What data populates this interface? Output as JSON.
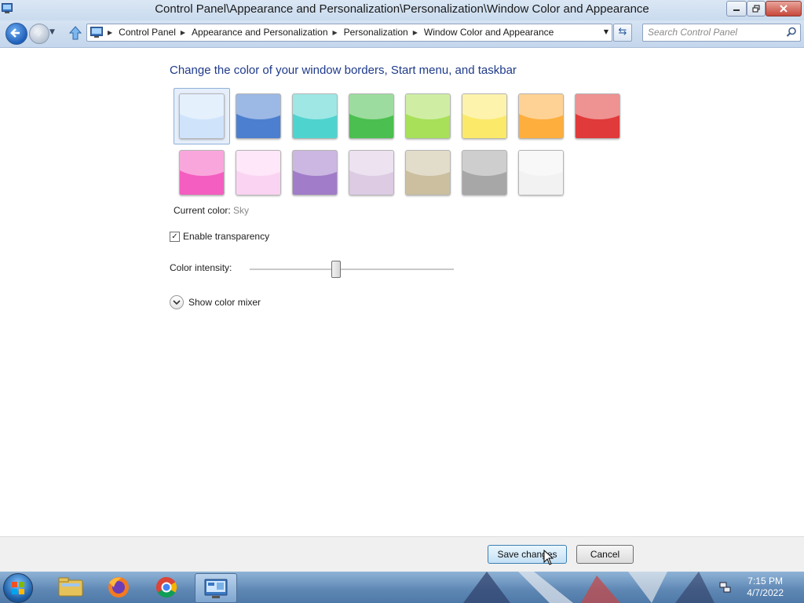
{
  "window": {
    "title": "Control Panel\\Appearance and Personalization\\Personalization\\Window Color and Appearance",
    "controls": {
      "minimize": "minimize-icon",
      "maximize": "restore-icon",
      "close": "close-icon"
    }
  },
  "navigation": {
    "breadcrumbs": [
      "Control Panel",
      "Appearance and Personalization",
      "Personalization",
      "Window Color and Appearance"
    ],
    "search_placeholder": "Search Control Panel",
    "icons": [
      "back-arrow-icon",
      "forward-arrow-icon",
      "up-arrow-icon",
      "refresh-icon",
      "search-icon"
    ]
  },
  "content": {
    "heading": "Change the color of your window borders, Start menu, and taskbar",
    "swatches": [
      {
        "color": "#cfe4fb",
        "selected": true
      },
      {
        "color": "#4c7fcf"
      },
      {
        "color": "#4fd3cf"
      },
      {
        "color": "#4bbf4f"
      },
      {
        "color": "#a8e05a"
      },
      {
        "color": "#fbe96a"
      },
      {
        "color": "#fdae3d"
      },
      {
        "color": "#e03a3a"
      },
      {
        "color": "#f45ec0"
      },
      {
        "color": "#fbd3f2"
      },
      {
        "color": "#a17cc9"
      },
      {
        "color": "#dccbe3"
      },
      {
        "color": "#cbbf9f"
      },
      {
        "color": "#a7a7a7"
      },
      {
        "color": "#f2f2f2"
      }
    ],
    "current_color_label": "Current color:",
    "current_color_value": "Sky",
    "transparency_label": "Enable transparency",
    "transparency_checked": true,
    "intensity_label": "Color intensity:",
    "intensity_fraction": 0.42,
    "mixer_label": "Show color mixer"
  },
  "footer": {
    "save_label": "Save changes",
    "cancel_label": "Cancel"
  },
  "taskbar": {
    "items": [
      "windows-explorer-icon",
      "firefox-icon",
      "chrome-icon",
      "control-panel-icon"
    ],
    "active_item": "control-panel-icon",
    "time": "7:15 PM",
    "date": "4/7/2022"
  }
}
